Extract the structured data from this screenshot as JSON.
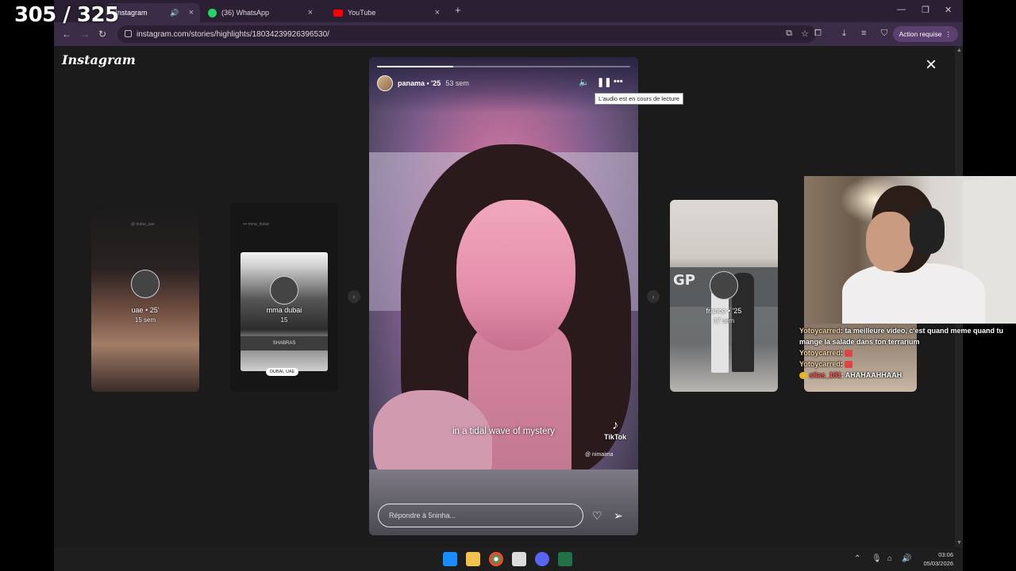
{
  "counter": "305 / 325",
  "tabs": [
    {
      "label": "- Instagram",
      "active": true
    },
    {
      "label": "(36) WhatsApp",
      "active": false
    },
    {
      "label": "YouTube",
      "active": false
    }
  ],
  "toolbar": {
    "url": "instagram.com/stories/highlights/18034239926396530/",
    "action_label": "Action requise"
  },
  "page": {
    "logo": "Instagram",
    "close_icon": "×"
  },
  "side_stories": [
    {
      "top_text": "@ dubai_uae",
      "label": "uae • 25'",
      "sub": "15 sem"
    },
    {
      "top_text": "••• mma_dubai",
      "label": "mma dubai",
      "sub": "15",
      "bar_text": "SHABRAS",
      "badge": "DUBAI, UAE"
    },
    {
      "label": "france • '25",
      "sub": "17 sem",
      "sign": "GP"
    }
  ],
  "main_story": {
    "progress": 0.3,
    "username": "panama • '25",
    "time": "53 sem",
    "tooltip": "L'audio est en cours de lecture",
    "caption": "in a tidal wave of mystery",
    "watermark": "TikTok",
    "watermark_user": "@ nimaima",
    "reply_placeholder": "Répondre à 5ninha..."
  },
  "chat": [
    {
      "user": "Yotoycarred",
      "text": "ta meilleure video, c'est quand meme quand tu mange la salade dans ton terrarium"
    },
    {
      "user": "Yotoycarred",
      "text": ""
    },
    {
      "user": "Yotoycarred",
      "text": ""
    },
    {
      "user": "silas_181",
      "text": "AHAHAAHHAAH"
    }
  ],
  "clock": {
    "time": "03:06",
    "date": "05/03/2026"
  },
  "colors": {
    "tab_bg": "#2b1f33",
    "toolbar_bg": "#3b2c48",
    "page_bg": "#1b1b1b",
    "action_btn": "#5b3f6e"
  }
}
